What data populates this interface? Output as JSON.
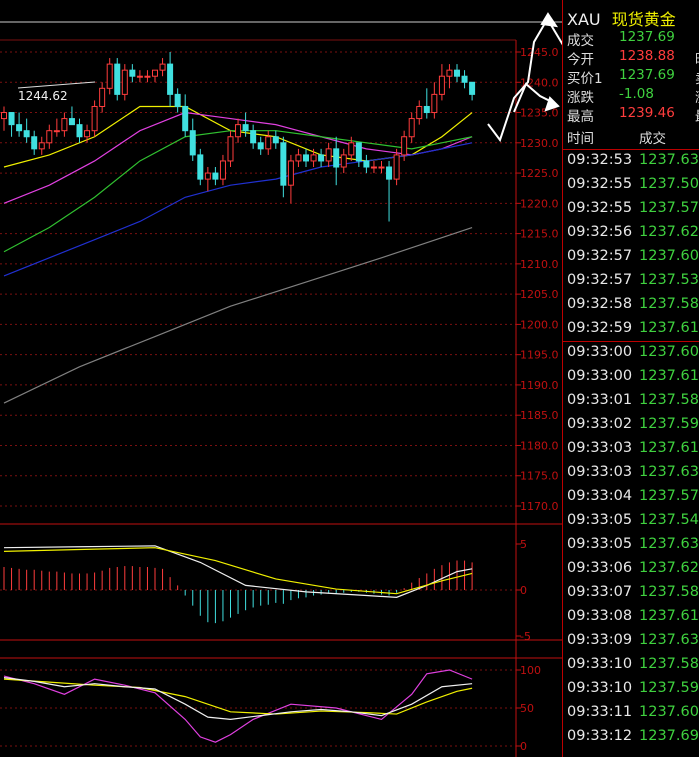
{
  "header": {
    "symbol": "XAU",
    "name": "现货黄金"
  },
  "quote": [
    {
      "label": "成交",
      "value": "1237.69",
      "color": "green",
      "extra": ""
    },
    {
      "label": "今开",
      "value": "1238.88",
      "color": "red",
      "extra": "昨"
    },
    {
      "label": "买价1",
      "value": "1237.69",
      "color": "green",
      "extra": "卖"
    },
    {
      "label": "涨跌",
      "value": "-1.08",
      "color": "green",
      "extra": "涨"
    },
    {
      "label": "最高",
      "value": "1239.46",
      "color": "red",
      "extra": "最"
    }
  ],
  "ticks_header": {
    "time": "时间",
    "price": "成交"
  },
  "ticks": [
    {
      "time": "09:32:53",
      "price": "1237.63"
    },
    {
      "time": "09:32:55",
      "price": "1237.50"
    },
    {
      "time": "09:32:55",
      "price": "1237.57"
    },
    {
      "time": "09:32:56",
      "price": "1237.62"
    },
    {
      "time": "09:32:57",
      "price": "1237.60"
    },
    {
      "time": "09:32:57",
      "price": "1237.53"
    },
    {
      "time": "09:32:58",
      "price": "1237.58"
    },
    {
      "time": "09:32:59",
      "price": "1237.61"
    },
    {
      "time": "09:33:00",
      "price": "1237.60"
    },
    {
      "time": "09:33:00",
      "price": "1237.61"
    },
    {
      "time": "09:33:01",
      "price": "1237.58"
    },
    {
      "time": "09:33:02",
      "price": "1237.59"
    },
    {
      "time": "09:33:03",
      "price": "1237.61"
    },
    {
      "time": "09:33:03",
      "price": "1237.63"
    },
    {
      "time": "09:33:04",
      "price": "1237.57"
    },
    {
      "time": "09:33:05",
      "price": "1237.54"
    },
    {
      "time": "09:33:05",
      "price": "1237.63"
    },
    {
      "time": "09:33:06",
      "price": "1237.62"
    },
    {
      "time": "09:33:07",
      "price": "1237.58"
    },
    {
      "time": "09:33:08",
      "price": "1237.61"
    },
    {
      "time": "09:33:09",
      "price": "1237.63"
    },
    {
      "time": "09:33:10",
      "price": "1237.58"
    },
    {
      "time": "09:33:10",
      "price": "1237.59"
    },
    {
      "time": "09:33:11",
      "price": "1237.60"
    },
    {
      "time": "09:33:12",
      "price": "1237.69"
    }
  ],
  "colors": {
    "up": "#ff3d3d",
    "down": "#3fd13f",
    "yellow": "#f0f000",
    "grid": "#7a1010",
    "axis": "#c01010"
  },
  "chart_data": {
    "type": "candlestick",
    "y_axis": {
      "min": 1170,
      "max": 1245,
      "ticks": [
        "1245.0",
        "1240.0",
        "1235.0",
        "1230.0",
        "1225.0",
        "1220.0",
        "1215.0",
        "1210.0",
        "1205.0",
        "1200.0",
        "1195.0",
        "1190.0",
        "1185.0",
        "1180.0",
        "1175.0",
        "1170.0"
      ]
    },
    "annotation": "1244.62",
    "candles": [
      [
        1234,
        1236,
        1232,
        1235
      ],
      [
        1235,
        1235,
        1231,
        1233
      ],
      [
        1233,
        1235,
        1231,
        1232
      ],
      [
        1232,
        1234,
        1230,
        1231
      ],
      [
        1231,
        1232,
        1228,
        1229
      ],
      [
        1229,
        1231,
        1228,
        1230
      ],
      [
        1230,
        1233,
        1229,
        1232
      ],
      [
        1232,
        1234,
        1231,
        1232
      ],
      [
        1232,
        1235,
        1231,
        1234
      ],
      [
        1234,
        1236,
        1233,
        1233
      ],
      [
        1233,
        1234,
        1230,
        1231
      ],
      [
        1231,
        1233,
        1230,
        1232
      ],
      [
        1232,
        1237,
        1231,
        1236
      ],
      [
        1236,
        1240,
        1235,
        1239
      ],
      [
        1239,
        1244,
        1238,
        1243
      ],
      [
        1243,
        1244,
        1237,
        1238
      ],
      [
        1238,
        1243,
        1237,
        1242
      ],
      [
        1242,
        1243,
        1240,
        1241
      ],
      [
        1241,
        1242,
        1240,
        1241
      ],
      [
        1241,
        1242,
        1240,
        1241
      ],
      [
        1241,
        1242,
        1240,
        1242
      ],
      [
        1242,
        1244,
        1241,
        1243
      ],
      [
        1243,
        1245,
        1236,
        1238
      ],
      [
        1238,
        1239,
        1235,
        1236
      ],
      [
        1236,
        1238,
        1231,
        1232
      ],
      [
        1232,
        1234,
        1227,
        1228
      ],
      [
        1228,
        1229,
        1223,
        1224
      ],
      [
        1224,
        1226,
        1222,
        1225
      ],
      [
        1225,
        1226,
        1223,
        1224
      ],
      [
        1224,
        1228,
        1223,
        1227
      ],
      [
        1227,
        1232,
        1226,
        1231
      ],
      [
        1231,
        1234,
        1230,
        1233
      ],
      [
        1233,
        1235,
        1231,
        1232
      ],
      [
        1232,
        1233,
        1229,
        1230
      ],
      [
        1230,
        1231,
        1228,
        1229
      ],
      [
        1229,
        1232,
        1228,
        1231
      ],
      [
        1231,
        1232,
        1229,
        1230
      ],
      [
        1230,
        1231,
        1221,
        1223
      ],
      [
        1223,
        1228,
        1220,
        1227
      ],
      [
        1227,
        1229,
        1226,
        1228
      ],
      [
        1228,
        1229,
        1226,
        1227
      ],
      [
        1227,
        1229,
        1226,
        1228
      ],
      [
        1228,
        1229,
        1226,
        1227
      ],
      [
        1227,
        1230,
        1226,
        1229
      ],
      [
        1229,
        1231,
        1223,
        1226
      ],
      [
        1226,
        1229,
        1225,
        1228
      ],
      [
        1228,
        1231,
        1227,
        1230
      ],
      [
        1230,
        1230,
        1226,
        1227
      ],
      [
        1227,
        1228,
        1225,
        1226
      ],
      [
        1226,
        1227,
        1225,
        1226
      ],
      [
        1226,
        1227,
        1225,
        1226
      ],
      [
        1226,
        1227,
        1217,
        1224
      ],
      [
        1224,
        1229,
        1223,
        1228
      ],
      [
        1228,
        1232,
        1227,
        1231
      ],
      [
        1231,
        1235,
        1230,
        1234
      ],
      [
        1234,
        1237,
        1233,
        1236
      ],
      [
        1236,
        1239,
        1234,
        1235
      ],
      [
        1235,
        1240,
        1234,
        1238
      ],
      [
        1238,
        1243,
        1237,
        1241
      ],
      [
        1241,
        1243,
        1239,
        1242
      ],
      [
        1242,
        1243,
        1240,
        1241
      ],
      [
        1241,
        1242,
        1239,
        1240
      ],
      [
        1240,
        1240,
        1237,
        1238
      ]
    ],
    "ma_lines": [
      {
        "color": "#f0f000",
        "points": [
          [
            0,
            1226
          ],
          [
            6,
            1228
          ],
          [
            12,
            1231
          ],
          [
            18,
            1236
          ],
          [
            24,
            1236
          ],
          [
            30,
            1232
          ],
          [
            36,
            1231
          ],
          [
            42,
            1228
          ],
          [
            48,
            1227
          ],
          [
            54,
            1228
          ],
          [
            58,
            1231
          ],
          [
            62,
            1235
          ]
        ]
      },
      {
        "color": "#e040e0",
        "points": [
          [
            0,
            1220
          ],
          [
            6,
            1223
          ],
          [
            12,
            1227
          ],
          [
            18,
            1232
          ],
          [
            24,
            1235
          ],
          [
            30,
            1234
          ],
          [
            36,
            1233
          ],
          [
            42,
            1231
          ],
          [
            48,
            1229
          ],
          [
            54,
            1228
          ],
          [
            58,
            1229
          ],
          [
            62,
            1231
          ]
        ]
      },
      {
        "color": "#30c030",
        "points": [
          [
            0,
            1212
          ],
          [
            6,
            1216
          ],
          [
            12,
            1221
          ],
          [
            18,
            1227
          ],
          [
            24,
            1231
          ],
          [
            30,
            1232
          ],
          [
            36,
            1232
          ],
          [
            42,
            1231
          ],
          [
            48,
            1230
          ],
          [
            54,
            1229
          ],
          [
            58,
            1230
          ],
          [
            62,
            1231
          ]
        ]
      },
      {
        "color": "#2030d0",
        "points": [
          [
            0,
            1208
          ],
          [
            6,
            1211
          ],
          [
            12,
            1214
          ],
          [
            18,
            1217
          ],
          [
            24,
            1221
          ],
          [
            30,
            1223
          ],
          [
            36,
            1224
          ],
          [
            42,
            1226
          ],
          [
            48,
            1227
          ],
          [
            54,
            1228
          ],
          [
            58,
            1229
          ],
          [
            62,
            1230
          ]
        ]
      },
      {
        "color": "#808080",
        "points": [
          [
            0,
            1187
          ],
          [
            10,
            1193
          ],
          [
            20,
            1198
          ],
          [
            30,
            1203
          ],
          [
            40,
            1207
          ],
          [
            50,
            1211
          ],
          [
            62,
            1216
          ]
        ]
      }
    ],
    "macd": {
      "y_axis": {
        "min": -5,
        "max": 5,
        "ticks": [
          "5",
          "0",
          "-5"
        ]
      },
      "hist": [
        2.5,
        2.4,
        2.3,
        2.2,
        2.2,
        2.1,
        2.0,
        2.0,
        1.9,
        1.8,
        1.8,
        1.8,
        1.9,
        2.1,
        2.4,
        2.5,
        2.6,
        2.6,
        2.5,
        2.5,
        2.4,
        2.3,
        1.4,
        0.5,
        -0.6,
        -1.7,
        -2.8,
        -3.5,
        -3.6,
        -3.4,
        -3.0,
        -2.6,
        -2.2,
        -1.9,
        -1.7,
        -1.6,
        -1.4,
        -1.5,
        -1.1,
        -0.9,
        -0.8,
        -0.6,
        -0.5,
        -0.4,
        -0.4,
        -0.3,
        -0.2,
        -0.2,
        -0.3,
        -0.4,
        -0.5,
        -0.6,
        -0.3,
        0.2,
        0.8,
        1.3,
        1.8,
        2.3,
        2.7,
        3.0,
        3.2,
        3.2,
        3.0
      ],
      "dif": [
        [
          0,
          4.6
        ],
        [
          10,
          4.7
        ],
        [
          20,
          4.8
        ],
        [
          26,
          3.0
        ],
        [
          32,
          0.5
        ],
        [
          40,
          -0.2
        ],
        [
          48,
          -0.6
        ],
        [
          52,
          -0.8
        ],
        [
          56,
          0.5
        ],
        [
          60,
          2.0
        ],
        [
          62,
          2.3
        ]
      ],
      "dea": [
        [
          0,
          4.2
        ],
        [
          10,
          4.4
        ],
        [
          20,
          4.6
        ],
        [
          28,
          3.2
        ],
        [
          36,
          1.2
        ],
        [
          44,
          0.1
        ],
        [
          52,
          -0.4
        ],
        [
          58,
          1.0
        ],
        [
          62,
          1.8
        ]
      ]
    },
    "kdj": {
      "y_axis": {
        "min": 0,
        "max": 100,
        "ticks": [
          "100",
          "50",
          "0"
        ]
      },
      "k": [
        [
          0,
          90
        ],
        [
          4,
          85
        ],
        [
          8,
          78
        ],
        [
          12,
          82
        ],
        [
          16,
          78
        ],
        [
          20,
          75
        ],
        [
          24,
          55
        ],
        [
          27,
          38
        ],
        [
          30,
          35
        ],
        [
          34,
          40
        ],
        [
          38,
          45
        ],
        [
          42,
          48
        ],
        [
          46,
          45
        ],
        [
          50,
          40
        ],
        [
          54,
          55
        ],
        [
          58,
          78
        ],
        [
          62,
          82
        ]
      ],
      "d": [
        [
          0,
          88
        ],
        [
          6,
          84
        ],
        [
          12,
          80
        ],
        [
          18,
          77
        ],
        [
          24,
          65
        ],
        [
          30,
          45
        ],
        [
          36,
          42
        ],
        [
          42,
          46
        ],
        [
          48,
          44
        ],
        [
          52,
          42
        ],
        [
          56,
          58
        ],
        [
          60,
          72
        ],
        [
          62,
          76
        ]
      ],
      "j": [
        [
          0,
          92
        ],
        [
          4,
          82
        ],
        [
          8,
          68
        ],
        [
          12,
          88
        ],
        [
          16,
          80
        ],
        [
          20,
          70
        ],
        [
          24,
          35
        ],
        [
          26,
          12
        ],
        [
          28,
          5
        ],
        [
          30,
          15
        ],
        [
          33,
          35
        ],
        [
          38,
          55
        ],
        [
          44,
          50
        ],
        [
          50,
          35
        ],
        [
          54,
          68
        ],
        [
          56,
          95
        ],
        [
          59,
          100
        ],
        [
          62,
          88
        ]
      ]
    }
  }
}
